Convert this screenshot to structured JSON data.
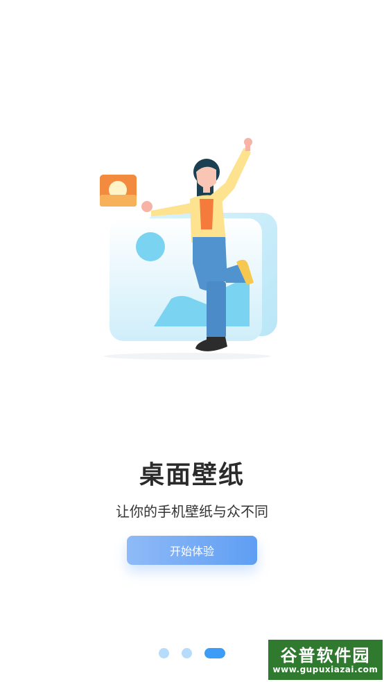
{
  "onboarding": {
    "title": "桌面壁纸",
    "subtitle": "让你的手机壁纸与众不同",
    "start_button": "开始体验"
  },
  "pagination": {
    "total": 3,
    "current": 3
  },
  "watermark": {
    "title": "谷普软件园",
    "url": "www.gupuxiazai.com"
  },
  "colors": {
    "accent": "#3d9cf6",
    "button_start": "#8fbaf7",
    "button_end": "#5f9ef3",
    "dot_inactive": "#b7dcfb",
    "title": "#2b2b2b"
  },
  "icons": [
    "wallpaper-illustration",
    "sun-photo-icon"
  ]
}
